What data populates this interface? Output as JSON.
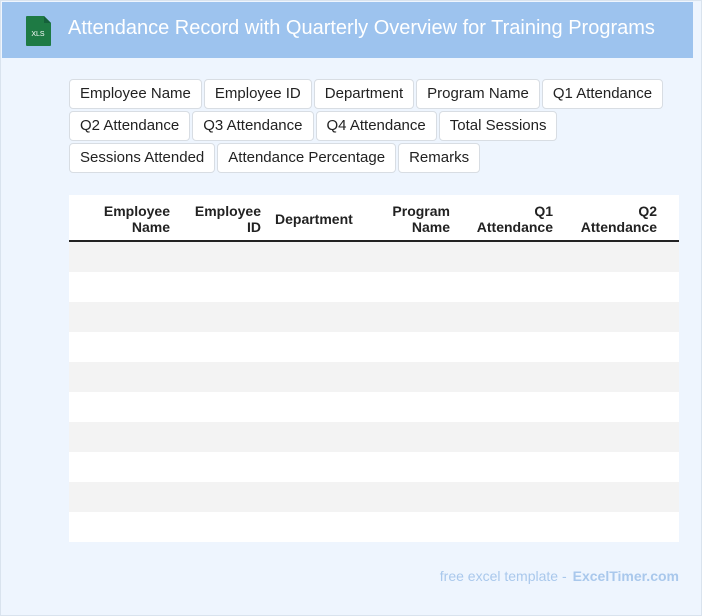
{
  "header": {
    "title": "Attendance Record with Quarterly Overview for Training Programs",
    "icon_label": "XLS"
  },
  "chips": [
    [
      "Employee Name",
      "Employee ID",
      "Department",
      "Program Name",
      "Q1 Attendance"
    ],
    [
      "Q2 Attendance",
      "Q3 Attendance",
      "Q4 Attendance",
      "Total Sessions"
    ],
    [
      "Sessions Attended",
      "Attendance Percentage",
      "Remarks"
    ]
  ],
  "table": {
    "columns": [
      {
        "line1": "Employee",
        "line2": "Name"
      },
      {
        "line1": "Employee",
        "line2": "ID"
      },
      {
        "line1": "Department",
        "line2": ""
      },
      {
        "line1": "Program",
        "line2": "Name"
      },
      {
        "line1": "Q1",
        "line2": "Attendance"
      },
      {
        "line1": "Q2",
        "line2": "Attendance"
      }
    ],
    "row_count": 10
  },
  "footer": {
    "prefix": "free excel template -",
    "brand": "ExcelTimer.com"
  },
  "colors": {
    "header_bg": "#9dc3ee",
    "page_bg": "#eef5fe",
    "icon_green": "#1e7a44",
    "footer_text": "#a9c8ec"
  }
}
